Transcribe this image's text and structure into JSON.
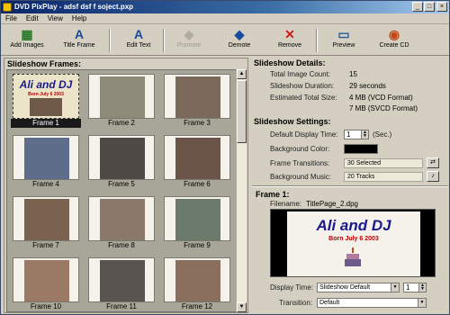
{
  "window": {
    "title": "DVD PixPlay - adsf dsf f soject.pxp"
  },
  "menu": [
    "File",
    "Edit",
    "View",
    "Help"
  ],
  "toolbar": [
    {
      "label": "Add Images",
      "icon": "add-images-icon",
      "disabled": false
    },
    {
      "label": "Title Frame",
      "icon": "title-frame-icon",
      "disabled": false
    },
    {
      "label": "Edit Text",
      "icon": "edit-text-icon",
      "disabled": false
    },
    {
      "label": "Promote",
      "icon": "promote-icon",
      "disabled": true
    },
    {
      "label": "Demote",
      "icon": "demote-icon",
      "disabled": false
    },
    {
      "label": "Remove",
      "icon": "remove-icon",
      "disabled": false
    },
    {
      "label": "Preview",
      "icon": "preview-icon",
      "disabled": false
    },
    {
      "label": "Create CD",
      "icon": "create-cd-icon",
      "disabled": false
    }
  ],
  "frames_panel": {
    "title": "Slideshow Frames:",
    "frames": [
      "Frame 1",
      "Frame 2",
      "Frame 3",
      "Frame 4",
      "Frame 5",
      "Frame 6",
      "Frame 7",
      "Frame 8",
      "Frame 9",
      "Frame 10",
      "Frame 11",
      "Frame 12"
    ],
    "title_frame_text": "Ali and DJ",
    "title_frame_sub": "Born July 6 2003"
  },
  "details": {
    "title": "Slideshow Details:",
    "image_count_label": "Total Image Count:",
    "image_count": "15",
    "duration_label": "Slideshow Duration:",
    "duration": "29 seconds",
    "size_label": "Estimated Total Size:",
    "size_vcd": "4 MB (VCD Format)",
    "size_svcd": "7 MB (SVCD Format)"
  },
  "settings": {
    "title": "Slideshow Settings:",
    "display_time_label": "Default Display Time:",
    "display_time": "1",
    "display_time_unit": "(Sec.)",
    "bg_color_label": "Background Color:",
    "bg_color": "#000000",
    "transitions_label": "Frame Transitions:",
    "transitions": "30 Selected",
    "music_label": "Background Music:",
    "music": "20 Tracks"
  },
  "frame_detail": {
    "title": "Frame 1:",
    "filename_label": "Filename:",
    "filename": "TitlePage_2.dpg",
    "preview_title": "Ali and DJ",
    "preview_sub": "Born July 6 2003",
    "display_time_label": "Display Time:",
    "display_time_option": "Slideshow Default",
    "display_time_value": "1",
    "transition_label": "Transition:",
    "transition_option": "Default"
  }
}
